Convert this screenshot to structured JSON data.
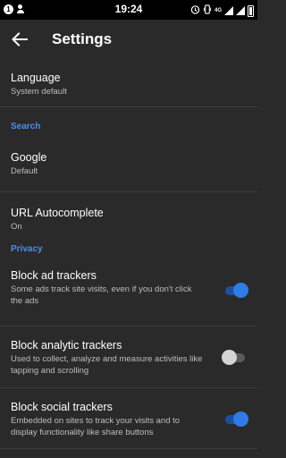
{
  "status_bar": {
    "notification_badge": "1",
    "time": "19:24",
    "network": "4G"
  },
  "header": {
    "title": "Settings"
  },
  "language": {
    "title": "Language",
    "value": "System default"
  },
  "search_section": {
    "header": "Search",
    "google": {
      "title": "Google",
      "value": "Default"
    },
    "autocomplete": {
      "title": "URL Autocomplete",
      "value": "On"
    }
  },
  "privacy_section": {
    "header": "Privacy",
    "ad_trackers": {
      "title": "Block ad trackers",
      "description": "Some ads track site visits, even if you don't click the ads",
      "enabled": true
    },
    "analytic_trackers": {
      "title": "Block analytic trackers",
      "description": "Used to collect, analyze and measure activities like tapping and scrolling",
      "enabled": false
    },
    "social_trackers": {
      "title": "Block social trackers",
      "description": "Embedded on sites to track your visits and to display functionality like share buttons",
      "enabled": true
    }
  },
  "colors": {
    "background": "#2a2a2a",
    "accent": "#2f7be8",
    "section_header": "#4b8fe8"
  }
}
